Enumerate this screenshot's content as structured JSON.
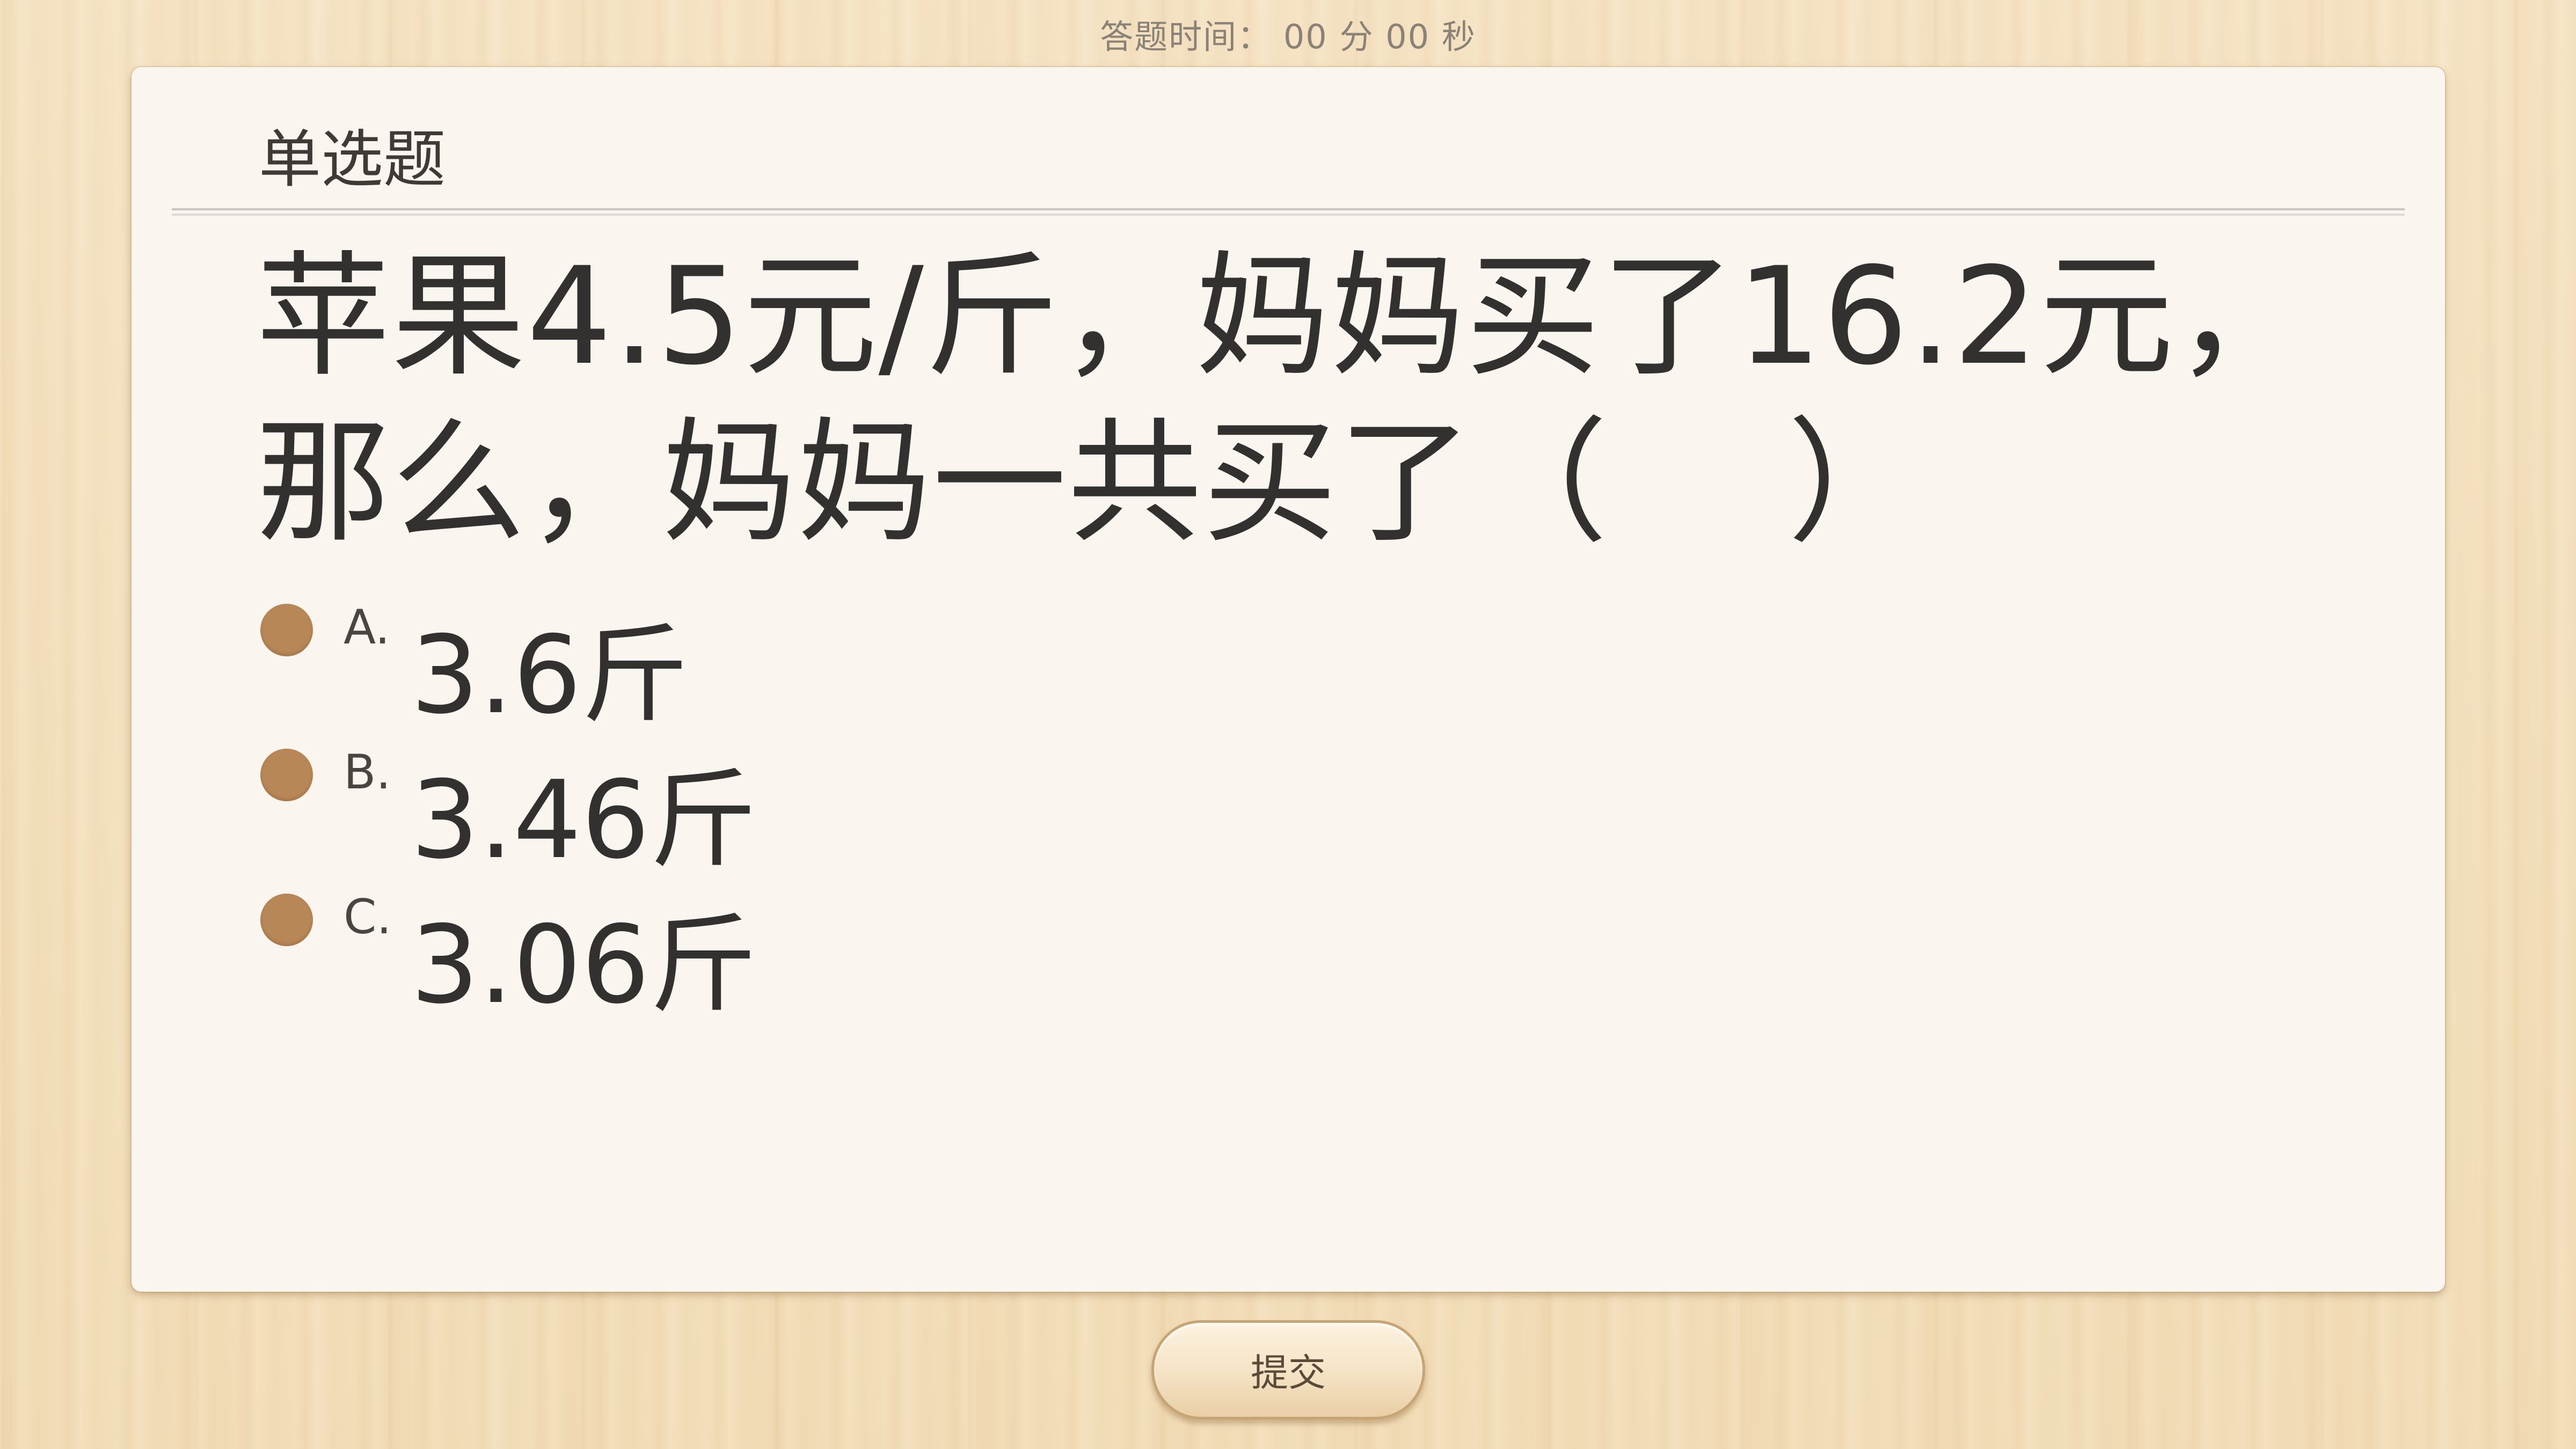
{
  "timer": {
    "label": "答题时间：",
    "minutes": "00",
    "minutes_unit": "分",
    "seconds": "00",
    "seconds_unit": "秒"
  },
  "card": {
    "question_type": "单选题",
    "question_text": "苹果4.5元/斤，妈妈买了16.2元，那么，妈妈一共买了（　 ）",
    "options": [
      {
        "letter": "A.",
        "text": "3.6斤"
      },
      {
        "letter": "B.",
        "text": "3.46斤"
      },
      {
        "letter": "C.",
        "text": "3.06斤"
      }
    ]
  },
  "submit": {
    "label": "提交"
  },
  "colors": {
    "radio": "#b88757",
    "card_bg": "#faf6ef",
    "wood_bg": "#f3dfbd"
  }
}
